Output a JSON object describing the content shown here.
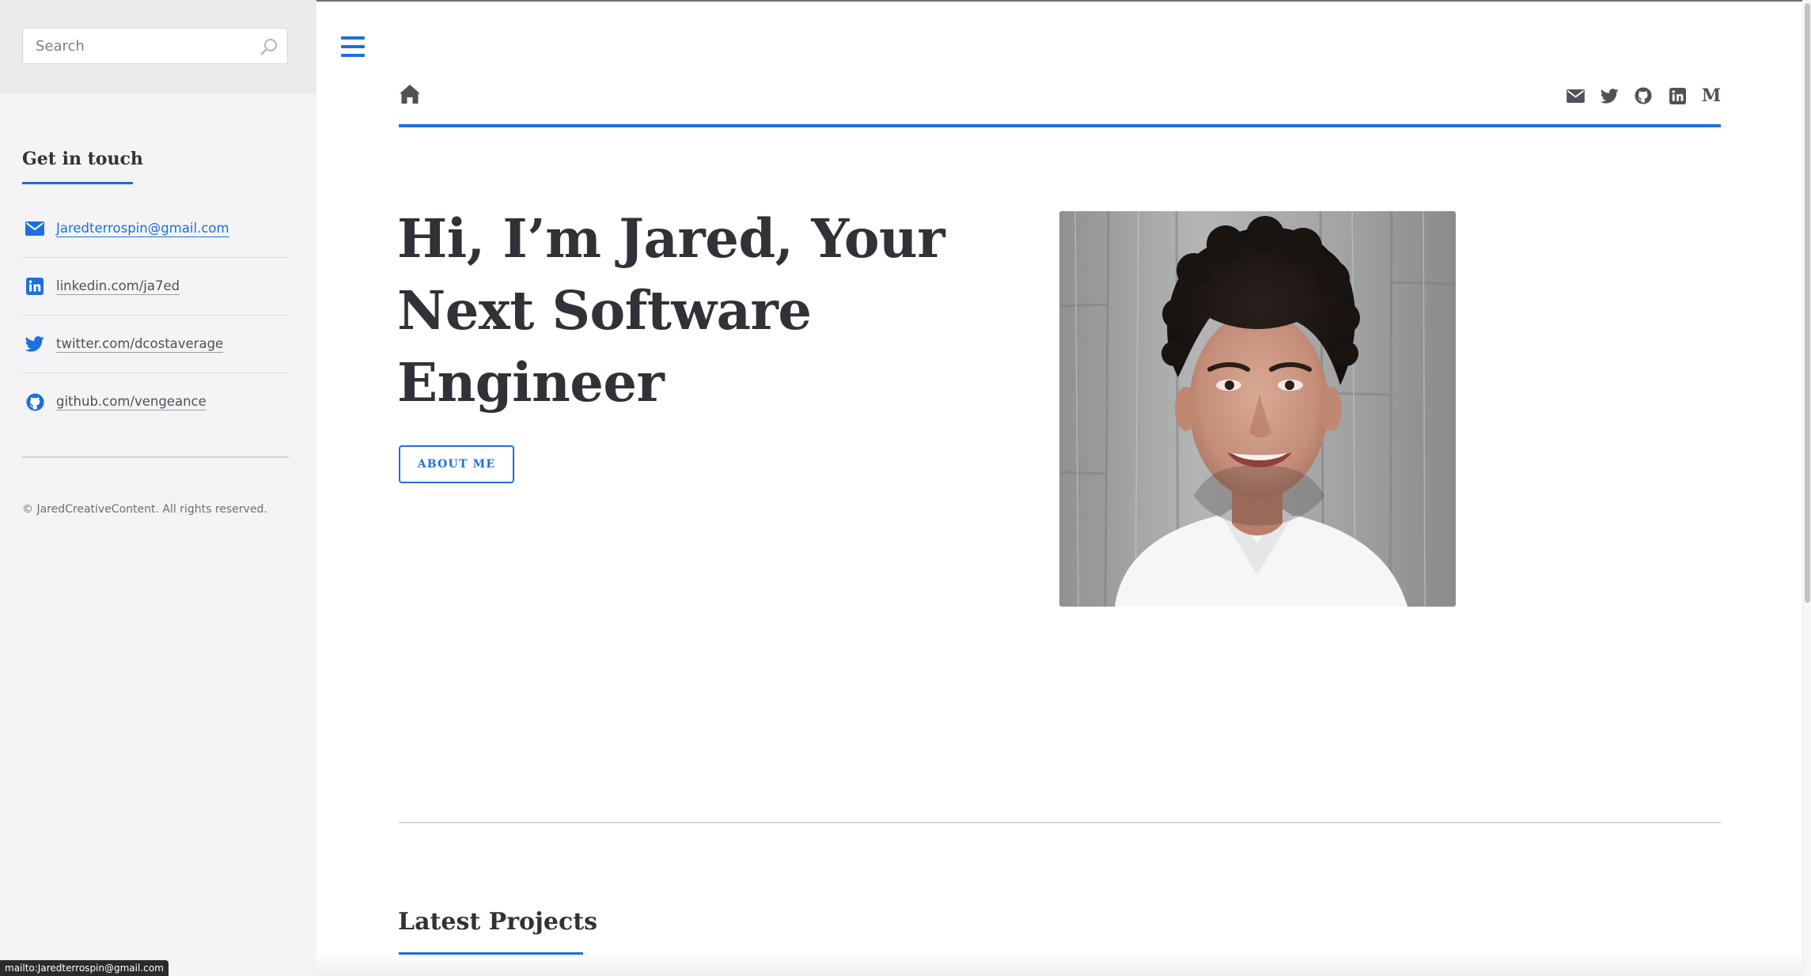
{
  "search": {
    "placeholder": "Search",
    "icon": "search-icon"
  },
  "sidebar": {
    "heading": "Get in touch",
    "contacts": [
      {
        "icon": "envelope-icon",
        "text": "Jaredterrospin@gmail.com",
        "accent": true
      },
      {
        "icon": "linkedin-icon",
        "text": "linkedin.com/ja7ed",
        "accent": false
      },
      {
        "icon": "twitter-icon",
        "text": "twitter.com/dcostaverage",
        "accent": false
      },
      {
        "icon": "github-icon",
        "text": "github.com/vengeance",
        "accent": false
      }
    ],
    "copyright": "© JaredCreativeContent. All rights reserved."
  },
  "nav": {
    "menu_icon": "hamburger-menu-icon",
    "home_icon": "home-icon",
    "social_icons": [
      "envelope-icon",
      "twitter-icon",
      "github-icon",
      "linkedin-icon",
      "medium-icon"
    ],
    "medium_glyph": "M"
  },
  "hero": {
    "title": "Hi, I’m Jared, Your Next Software Engineer",
    "button_label": "ABOUT ME",
    "image_alt": "portrait-photo"
  },
  "sections": {
    "latest_projects": "Latest Projects"
  },
  "status_bar": {
    "text": "mailto:Jaredterrospin@gmail.com"
  },
  "colors": {
    "accent": "#1c6fe0",
    "text": "#2f3338",
    "sidebar_bg": "#f4f4f6",
    "icon_gray": "#4e5359"
  }
}
